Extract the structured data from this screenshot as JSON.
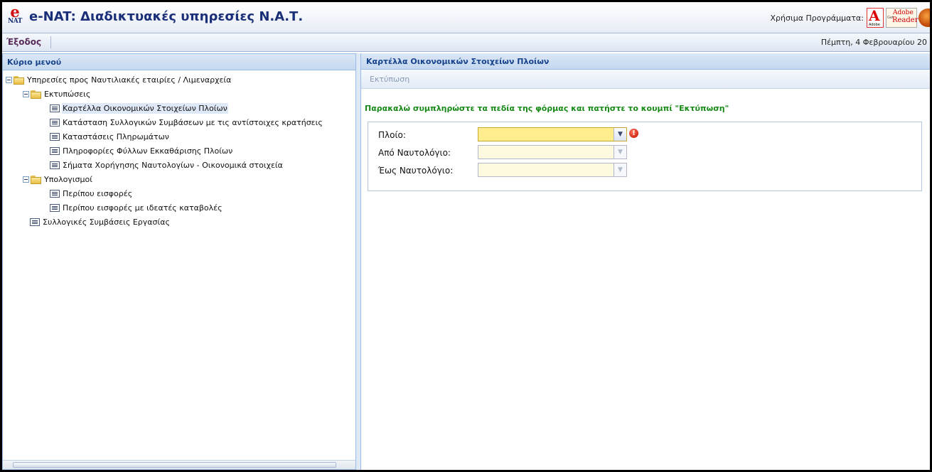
{
  "header": {
    "logo_letter": "e",
    "logo_sub": "NAT",
    "title": "e-NAT: Διαδικτυακές υπηρεσίες Ν.Α.Τ.",
    "useful_programs_label": "Χρήσιμα Προγράμματα:",
    "acrobat_sub": "Adobe",
    "reader_get": "Get",
    "reader_adobe": "Adobe",
    "reader_reader": "Reader"
  },
  "toolbar": {
    "exit_label": "Έξοδος",
    "date": "Πέμπτη, 4 Φεβρουαρίου 20"
  },
  "left_panel": {
    "title": "Κύριο μενού",
    "tree": [
      {
        "label": "Υπηρεσίες προς Ναυτιλιακές εταιρίες / Λιμεναρχεία",
        "type": "folder"
      },
      {
        "label": "Εκτυπώσεις",
        "type": "folder"
      },
      {
        "label": "Καρτέλλα Οικονομικών Στοιχείων Πλοίων",
        "type": "leaf",
        "selected": true
      },
      {
        "label": "Κατάσταση Συλλογικών Συμβάσεων με τις αντίστοιχες κρατήσεις",
        "type": "leaf"
      },
      {
        "label": "Καταστάσεις Πληρωμάτων",
        "type": "leaf"
      },
      {
        "label": "Πληροφορίες Φύλλων Εκκαθάρισης Πλοίων",
        "type": "leaf"
      },
      {
        "label": "Σήματα Χορήγησης Ναυτολογίων - Οικονομικά στοιχεία",
        "type": "leaf"
      },
      {
        "label": "Υπολογισμοί",
        "type": "folder"
      },
      {
        "label": "Περίπου εισφορές",
        "type": "leaf"
      },
      {
        "label": "Περίπου εισφορές με ιδεατές καταβολές",
        "type": "leaf"
      },
      {
        "label": "Συλλογικές Συμβάσεις Εργασίας",
        "type": "leaf"
      }
    ]
  },
  "right_panel": {
    "title": "Καρτέλλα Οικονομικών Στοιχείων Πλοίων",
    "print_label": "Εκτύπωση",
    "instruction": "Παρακαλώ συμπληρώστε τα πεδία της φόρμας και πατήστε το κουμπί \"Εκτύπωση\"",
    "form": {
      "ship_label": "Πλοίο:",
      "ship_value": "",
      "from_label": "Από Ναυτολόγιο:",
      "from_value": "",
      "to_label": "Έως Ναυτολόγιο:",
      "to_value": ""
    },
    "error_mark": "!"
  }
}
